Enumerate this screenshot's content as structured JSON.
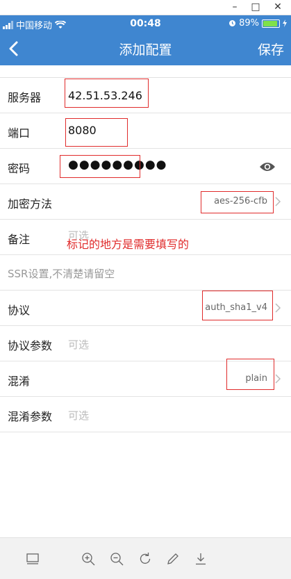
{
  "window": {
    "minimize": "–",
    "maximize": "□",
    "close": "✕"
  },
  "status_bar": {
    "carrier": "中国移动",
    "time": "00:48",
    "battery": "89%",
    "battery_level": 0.89
  },
  "nav": {
    "title": "添加配置",
    "save_label": "保存",
    "back_icon": "chevron-left-icon"
  },
  "form": {
    "server": {
      "label": "服务器",
      "value": "42.51.53.246"
    },
    "port": {
      "label": "端口",
      "value": "8080"
    },
    "password": {
      "label": "密码",
      "value": "●●●●●●●●●"
    },
    "encryption": {
      "label": "加密方法",
      "value": "aes-256-cfb"
    },
    "remark": {
      "label": "备注",
      "placeholder": "可选"
    },
    "ssr_section": "SSR设置,不清楚请留空",
    "protocol": {
      "label": "协议",
      "value": "auth_sha1_v4"
    },
    "protocol_param": {
      "label": "协议参数",
      "placeholder": "可选"
    },
    "obfs": {
      "label": "混淆",
      "value": "plain"
    },
    "obfs_param": {
      "label": "混淆参数",
      "placeholder": "可选"
    }
  },
  "annotation": {
    "text": "标记的地方是需要填写的",
    "color": "#e02b2b"
  },
  "colors": {
    "accent": "#3f86d0",
    "annotation": "#e02b2b"
  },
  "toolbar_icons": [
    "panel-icon",
    "zoom-in-icon",
    "zoom-out-icon",
    "rotate-icon",
    "pen-icon",
    "download-icon"
  ]
}
